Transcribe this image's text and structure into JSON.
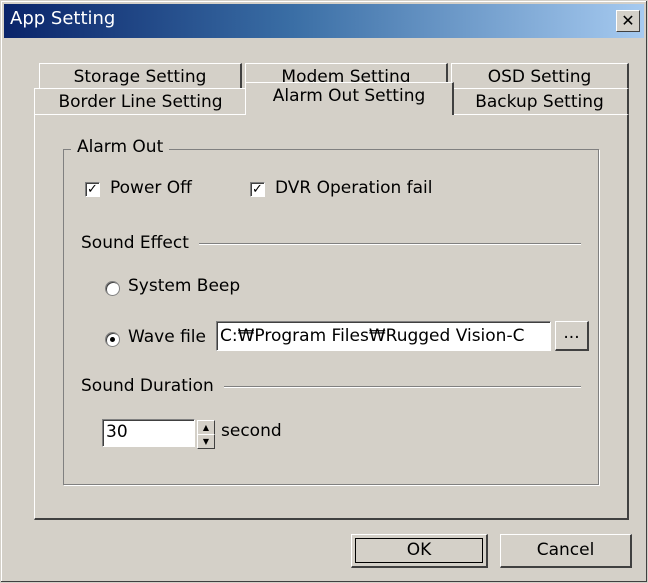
{
  "window": {
    "title": "App Setting",
    "close_glyph": "✕"
  },
  "tabs": {
    "back_row": [
      "Storage Setting",
      "Modem Setting",
      "OSD Setting"
    ],
    "front_row": [
      "Border Line Setting",
      "Alarm Out Setting",
      "Backup Setting"
    ],
    "active": "Alarm Out Setting"
  },
  "alarm_out": {
    "group_label": "Alarm Out",
    "power_off": {
      "label": "Power Off",
      "checked": true
    },
    "dvr_fail": {
      "label": "DVR Operation fail",
      "checked": true
    },
    "sound_effect_label": "Sound Effect",
    "system_beep": {
      "label": "System Beep",
      "selected": false
    },
    "wave_file": {
      "label": "Wave file",
      "selected": true,
      "path": "C:₩Program Files₩Rugged Vision-C"
    },
    "browse_label": "...",
    "sound_duration_label": "Sound Duration",
    "duration_value": "30",
    "duration_unit": "second"
  },
  "buttons": {
    "ok": "OK",
    "cancel": "Cancel"
  },
  "icons": {
    "check": "✓",
    "spin_up": "▲",
    "spin_down": "▼"
  }
}
